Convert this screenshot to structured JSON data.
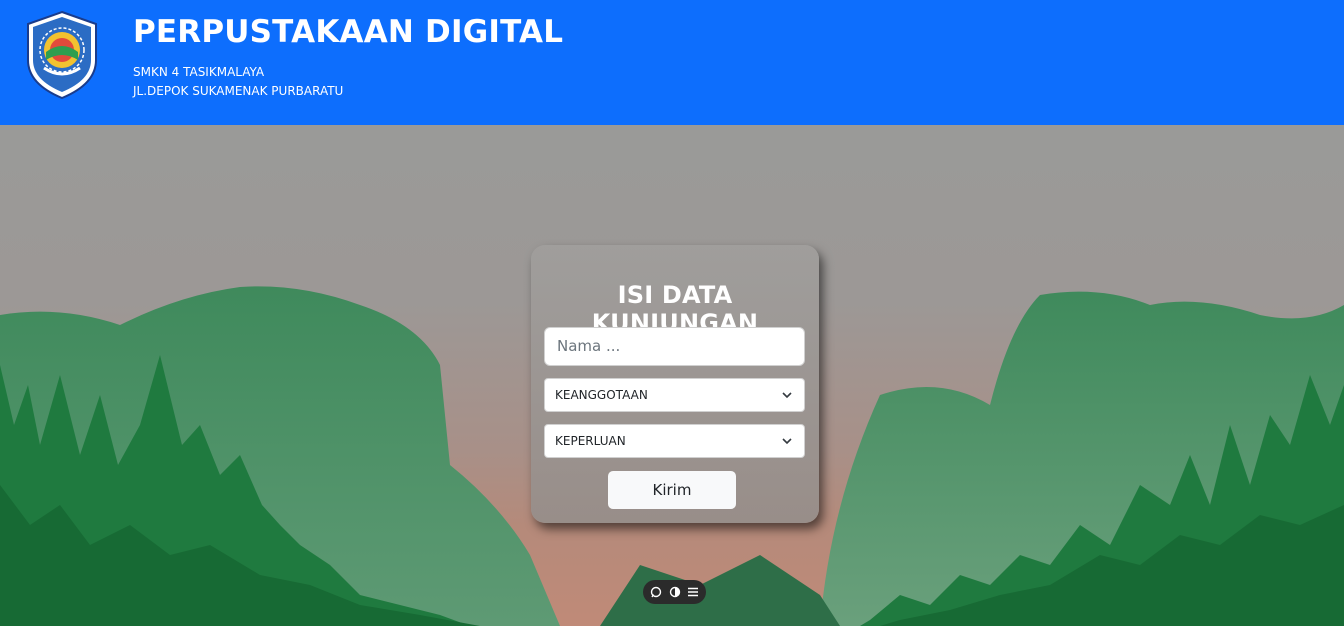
{
  "header": {
    "title": "PERPUSTAKAAN DIGITAL",
    "school": "SMKN 4 TASIKMALAYA",
    "address": "JL.DEPOK SUKAMENAK PURBARATU",
    "logo_icon": "school-emblem-icon",
    "background_color": "#0d6efd"
  },
  "form": {
    "title": "ISI DATA KUNJUNGAN",
    "name_placeholder": "Nama ...",
    "membership_selected": "KEANGGOTAAN",
    "purpose_selected": "KEPERLUAN",
    "submit_label": "Kirim"
  },
  "toolbar": {
    "icons": [
      "chat-icon",
      "contrast-icon",
      "menu-icon"
    ]
  }
}
